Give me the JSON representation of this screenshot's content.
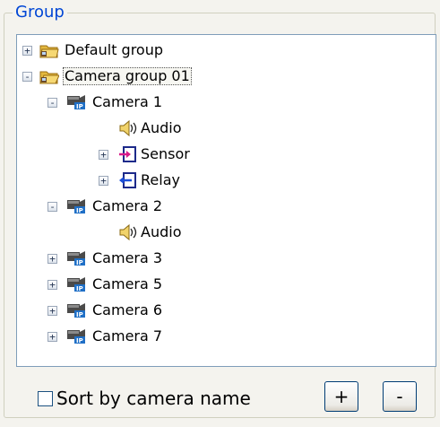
{
  "group_box": {
    "title": "Group"
  },
  "tree": {
    "items": [
      {
        "label": "Default group",
        "expander": "+"
      },
      {
        "label": "Camera group 01",
        "expander": "-"
      },
      {
        "label": "Camera 1",
        "expander": "-"
      },
      {
        "label": "Audio"
      },
      {
        "label": "Sensor",
        "expander": "+"
      },
      {
        "label": "Relay",
        "expander": "+"
      },
      {
        "label": "Camera 2",
        "expander": "-"
      },
      {
        "label": "Audio"
      },
      {
        "label": "Camera 3",
        "expander": "+"
      },
      {
        "label": "Camera 5",
        "expander": "+"
      },
      {
        "label": "Camera 6",
        "expander": "+"
      },
      {
        "label": "Camera 7",
        "expander": "+"
      }
    ]
  },
  "footer": {
    "sort_checkbox_label": "Sort by camera name",
    "sort_checked": false,
    "add_label": "+",
    "remove_label": "-"
  }
}
